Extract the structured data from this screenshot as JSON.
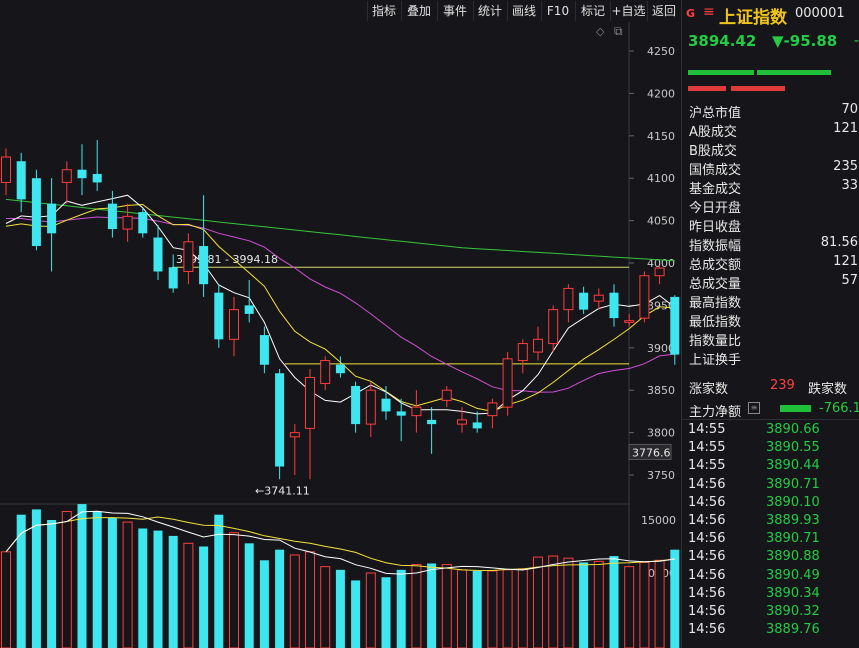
{
  "toolbar": {
    "buttons": [
      "指标",
      "叠加",
      "事件",
      "统计",
      "画线",
      "F10",
      "标记",
      "+自选",
      "返回"
    ]
  },
  "chart": {
    "price_axis_labels": [
      "4250",
      "4200",
      "4150",
      "4100",
      "4050",
      "4000",
      "3950",
      "3900",
      "3850",
      "3800",
      "3750"
    ],
    "current_price_marker": "3776.6",
    "annotation_range": "3995.81 - 3994.18",
    "annotation_low": "←3741.11",
    "volume_axis_labels": [
      "15000",
      "10000"
    ],
    "colors": {
      "up": "#ff3b3b",
      "down": "#3ee6f0",
      "ma5": "#ffffff",
      "ma10": "#f5e23c",
      "ma20": "#d24ed6",
      "ma60": "#37c53a"
    }
  },
  "chart_data": {
    "type": "candlestick",
    "ylim": [
      3720,
      4270
    ],
    "candles": [
      {
        "o": 4095,
        "h": 4135,
        "l": 4080,
        "c": 4125
      },
      {
        "o": 4120,
        "h": 4130,
        "l": 4060,
        "c": 4075
      },
      {
        "o": 4100,
        "h": 4110,
        "l": 4015,
        "c": 4020
      },
      {
        "o": 4070,
        "h": 4100,
        "l": 3990,
        "c": 4035
      },
      {
        "o": 4095,
        "h": 4120,
        "l": 4070,
        "c": 4110
      },
      {
        "o": 4110,
        "h": 4140,
        "l": 4080,
        "c": 4100
      },
      {
        "o": 4105,
        "h": 4145,
        "l": 4085,
        "c": 4095
      },
      {
        "o": 4070,
        "h": 4085,
        "l": 4030,
        "c": 4040
      },
      {
        "o": 4040,
        "h": 4070,
        "l": 4025,
        "c": 4055
      },
      {
        "o": 4060,
        "h": 4065,
        "l": 4030,
        "c": 4035
      },
      {
        "o": 4030,
        "h": 4045,
        "l": 3980,
        "c": 3990
      },
      {
        "o": 3995,
        "h": 4010,
        "l": 3965,
        "c": 3970
      },
      {
        "o": 3990,
        "h": 4035,
        "l": 3975,
        "c": 4025
      },
      {
        "o": 4020,
        "h": 4080,
        "l": 3960,
        "c": 3975
      },
      {
        "o": 3965,
        "h": 3975,
        "l": 3900,
        "c": 3910
      },
      {
        "o": 3910,
        "h": 3960,
        "l": 3890,
        "c": 3945
      },
      {
        "o": 3950,
        "h": 3980,
        "l": 3930,
        "c": 3940
      },
      {
        "o": 3915,
        "h": 3925,
        "l": 3870,
        "c": 3880
      },
      {
        "o": 3870,
        "h": 3875,
        "l": 3745,
        "c": 3760
      },
      {
        "o": 3795,
        "h": 3810,
        "l": 3750,
        "c": 3800
      },
      {
        "o": 3805,
        "h": 3875,
        "l": 3745,
        "c": 3865
      },
      {
        "o": 3858,
        "h": 3890,
        "l": 3850,
        "c": 3885
      },
      {
        "o": 3880,
        "h": 3890,
        "l": 3865,
        "c": 3870
      },
      {
        "o": 3855,
        "h": 3860,
        "l": 3800,
        "c": 3810
      },
      {
        "o": 3810,
        "h": 3860,
        "l": 3795,
        "c": 3850
      },
      {
        "o": 3840,
        "h": 3855,
        "l": 3815,
        "c": 3825
      },
      {
        "o": 3825,
        "h": 3840,
        "l": 3790,
        "c": 3820
      },
      {
        "o": 3820,
        "h": 3850,
        "l": 3800,
        "c": 3830
      },
      {
        "o": 3815,
        "h": 3830,
        "l": 3775,
        "c": 3810
      },
      {
        "o": 3838,
        "h": 3855,
        "l": 3830,
        "c": 3850
      },
      {
        "o": 3810,
        "h": 3830,
        "l": 3800,
        "c": 3815
      },
      {
        "o": 3812,
        "h": 3825,
        "l": 3800,
        "c": 3805
      },
      {
        "o": 3820,
        "h": 3840,
        "l": 3805,
        "c": 3835
      },
      {
        "o": 3830,
        "h": 3895,
        "l": 3820,
        "c": 3887
      },
      {
        "o": 3885,
        "h": 3910,
        "l": 3870,
        "c": 3905
      },
      {
        "o": 3895,
        "h": 3925,
        "l": 3885,
        "c": 3910
      },
      {
        "o": 3905,
        "h": 3950,
        "l": 3895,
        "c": 3945
      },
      {
        "o": 3945,
        "h": 3975,
        "l": 3930,
        "c": 3970
      },
      {
        "o": 3965,
        "h": 3972,
        "l": 3940,
        "c": 3945
      },
      {
        "o": 3955,
        "h": 3970,
        "l": 3945,
        "c": 3962
      },
      {
        "o": 3965,
        "h": 3975,
        "l": 3925,
        "c": 3935
      },
      {
        "o": 3930,
        "h": 3940,
        "l": 3925,
        "c": 3932
      },
      {
        "o": 3935,
        "h": 3990,
        "l": 3930,
        "c": 3985
      },
      {
        "o": 3985,
        "h": 3996,
        "l": 3975,
        "c": 3994
      },
      {
        "o": 3960,
        "h": 3962,
        "l": 3880,
        "c": 3892
      }
    ],
    "volumes": [
      12000,
      15500,
      16000,
      15000,
      15800,
      16500,
      15800,
      15200,
      14800,
      14200,
      14000,
      13500,
      12800,
      12500,
      15500,
      13800,
      12800,
      11200,
      12200,
      11700,
      12000,
      10600,
      10300,
      9300,
      10000,
      9600,
      10300,
      10800,
      10900,
      10800,
      10300,
      10200,
      10200,
      10300,
      10400,
      11500,
      11600,
      11400,
      11000,
      11100,
      11600,
      10600,
      11000,
      11200,
      12200
    ]
  },
  "panel": {
    "g_label": "G",
    "menu_icon": "hamburger-icon",
    "title": "上证指数",
    "code": "000001",
    "price": "3894.42",
    "change": "▼-95.88",
    "dash": "-",
    "stats": [
      {
        "label": "沪总市值",
        "value": "70"
      },
      {
        "label": "A股成交",
        "value": "121"
      },
      {
        "label": "B股成交",
        "value": ""
      },
      {
        "label": "国债成交",
        "value": "235"
      },
      {
        "label": "基金成交",
        "value": "33"
      },
      {
        "label": "今日开盘",
        "value": ""
      },
      {
        "label": "昨日收盘",
        "value": ""
      },
      {
        "label": "指数振幅",
        "value": "81.56"
      },
      {
        "label": "总成交额",
        "value": "121"
      },
      {
        "label": "总成交量",
        "value": "57"
      },
      {
        "label": "最高指数",
        "value": ""
      },
      {
        "label": "最低指数",
        "value": ""
      },
      {
        "label": "指数量比",
        "value": ""
      },
      {
        "label": "上证换手",
        "value": ""
      }
    ],
    "up_label": "涨家数",
    "up_count": "239",
    "down_label": "跌家数",
    "main_flow_label": "主力净额",
    "main_flow_value": "-766.1",
    "ticks": [
      {
        "time": "14:55",
        "price": "3890.66"
      },
      {
        "time": "14:55",
        "price": "3890.55"
      },
      {
        "time": "14:55",
        "price": "3890.44"
      },
      {
        "time": "14:56",
        "price": "3890.71"
      },
      {
        "time": "14:56",
        "price": "3890.10"
      },
      {
        "time": "14:56",
        "price": "3889.93"
      },
      {
        "time": "14:56",
        "price": "3890.71"
      },
      {
        "time": "14:56",
        "price": "3890.88"
      },
      {
        "time": "14:56",
        "price": "3890.49"
      },
      {
        "time": "14:56",
        "price": "3890.34"
      },
      {
        "time": "14:56",
        "price": "3890.32"
      },
      {
        "time": "14:56",
        "price": "3889.76"
      }
    ]
  }
}
